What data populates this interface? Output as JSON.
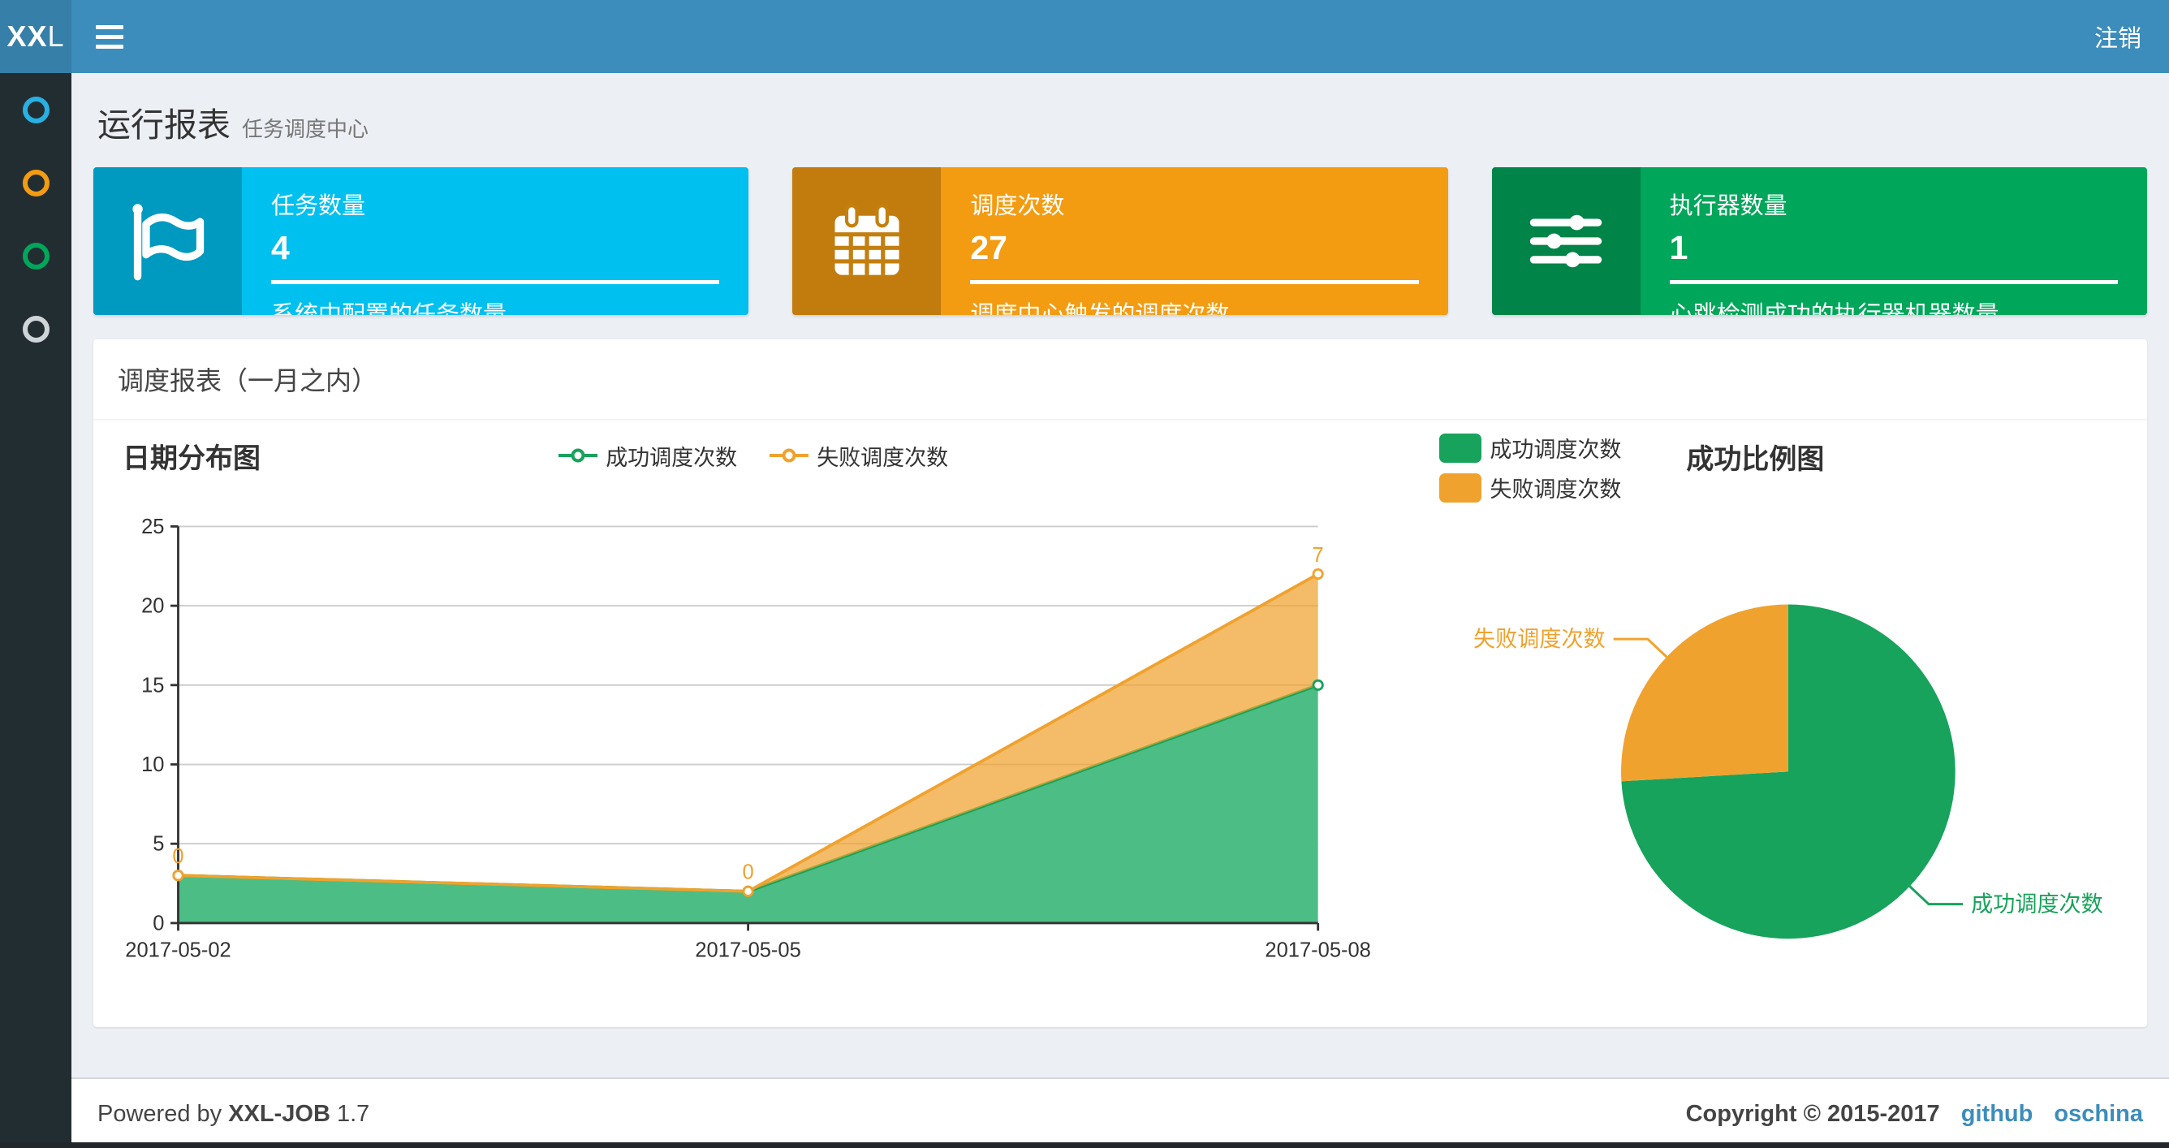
{
  "navbar": {
    "logo_bold": "XX",
    "logo_light": "L",
    "logout_label": "注销"
  },
  "sidebar": {
    "items": [
      {
        "name": "menu-dashboard",
        "color": "#29b0e2"
      },
      {
        "name": "menu-jobs",
        "color": "#f39c12"
      },
      {
        "name": "menu-executors",
        "color": "#00a65a"
      },
      {
        "name": "menu-help",
        "color": "#cfd4d8"
      }
    ]
  },
  "page": {
    "title": "运行报表",
    "subtitle": "任务调度中心"
  },
  "cards": [
    {
      "title": "任务数量",
      "value": "4",
      "desc": "系统中配置的任务数量",
      "color": "#00c0ef",
      "icon": "flag-icon"
    },
    {
      "title": "调度次数",
      "value": "27",
      "desc": "调度中心触发的调度次数",
      "color": "#f39c12",
      "icon": "calendar-icon"
    },
    {
      "title": "执行器数量",
      "value": "1",
      "desc": "心跳检测成功的执行器机器数量",
      "color": "#00a65a",
      "icon": "sliders-icon"
    }
  ],
  "panel": {
    "header": "调度报表（一月之内）"
  },
  "line_chart": {
    "title": "日期分布图",
    "legend": [
      {
        "label": "成功调度次数",
        "color": "#17a35b"
      },
      {
        "label": "失败调度次数",
        "color": "#f0a22e"
      }
    ]
  },
  "pie_chart": {
    "title": "成功比例图",
    "legend": [
      {
        "label": "成功调度次数",
        "color": "#17a35b"
      },
      {
        "label": "失败调度次数",
        "color": "#f0a22e"
      }
    ]
  },
  "footer": {
    "powered_prefix": "Powered by ",
    "powered_app": "XXL-JOB",
    "powered_version": " 1.7",
    "copyright": "Copyright © 2015-2017",
    "links": [
      {
        "label": "github"
      },
      {
        "label": "oschina"
      }
    ]
  },
  "colors": {
    "navbar": "#3c8dbc",
    "logo": "#367fa9",
    "sidebar": "#222d32",
    "content_bg": "#ecf0f5",
    "link": "#3c8dbc",
    "success": "#17a35b",
    "fail": "#f0a22e"
  },
  "chart_data": [
    {
      "type": "area",
      "title": "日期分布图",
      "x": [
        "2017-05-02",
        "2017-05-05",
        "2017-05-08"
      ],
      "stacked": true,
      "ylim": [
        0,
        25
      ],
      "yticks": [
        0,
        5,
        10,
        15,
        20,
        25
      ],
      "grid": true,
      "legend_position": "top-center",
      "series": [
        {
          "name": "成功调度次数",
          "values": [
            3,
            2,
            15
          ],
          "color": "#17a35b",
          "fill": "#4cbd85",
          "show_labels": false
        },
        {
          "name": "失败调度次数",
          "values": [
            0,
            0,
            7
          ],
          "color": "#f0a22e",
          "fill": "rgba(240,162,46,0.72)",
          "show_labels": true,
          "labels": [
            "0",
            "0",
            "7"
          ]
        }
      ]
    },
    {
      "type": "pie",
      "title": "成功比例图",
      "legend_position": "top-left",
      "slices": [
        {
          "name": "成功调度次数",
          "value": 20,
          "color": "#17a35b"
        },
        {
          "name": "失败调度次数",
          "value": 7,
          "color": "#f0a22e"
        }
      ]
    }
  ]
}
